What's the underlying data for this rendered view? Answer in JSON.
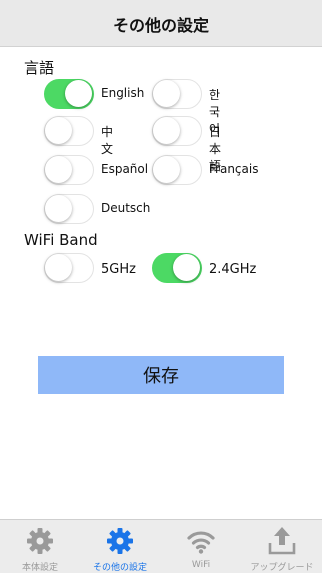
{
  "header": {
    "title": "その他の設定"
  },
  "language": {
    "label": "言語",
    "options": [
      {
        "label": "English",
        "on": true
      },
      {
        "label": "한국어",
        "on": false
      },
      {
        "label": "中文",
        "on": false
      },
      {
        "label": "日本語",
        "on": false
      },
      {
        "label": "Español",
        "on": false
      },
      {
        "label": "Français",
        "on": false
      },
      {
        "label": "Deutsch",
        "on": false
      }
    ]
  },
  "wifi_band": {
    "label": "WiFi Band",
    "options": [
      {
        "label": "5GHz",
        "on": false
      },
      {
        "label": "2.4GHz",
        "on": true
      }
    ]
  },
  "save_label": "保存",
  "tabbar": {
    "tabs": [
      {
        "label": "本体設定",
        "icon": "gear-icon",
        "active": false
      },
      {
        "label": "その他の設定",
        "icon": "gear-icon",
        "active": true
      },
      {
        "label": "WiFi",
        "icon": "wifi-icon",
        "active": false
      },
      {
        "label": "アップグレード",
        "icon": "upload-icon",
        "active": false
      }
    ]
  },
  "colors": {
    "toggle_on": "#4cd964",
    "save_bg": "#8fb8f8",
    "tab_active": "#1a74e8",
    "tab_inactive": "#9a9a9a"
  }
}
